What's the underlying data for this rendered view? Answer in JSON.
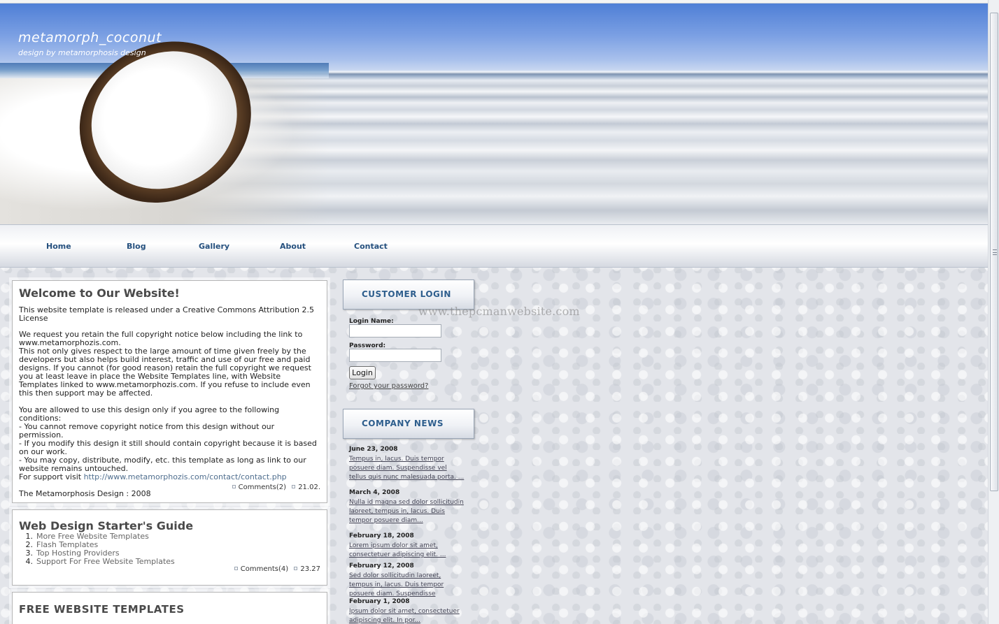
{
  "site": {
    "title": "metamorph_coconut",
    "subtitle": "design by metamorphosis design"
  },
  "nav": {
    "items": [
      "Home",
      "Blog",
      "Gallery",
      "About",
      "Contact"
    ]
  },
  "welcome": {
    "title": "Welcome to Our Website!",
    "p1": "This website template is released under a Creative Commons Attribution 2.5 License",
    "p2_lines": [
      "We request you retain the full copyright notice below including the link to www.metamorphozis.com.",
      "This not only gives respect to the large amount of time given freely by the developers but also helps build interest, traffic and use of our free and paid designs. If you cannot (for good reason) retain the full copyright we request you at least leave in place the Website Templates line, with Website Templates linked to www.metamorphozis.com. If you refuse to include even this then support may be affected."
    ],
    "p3_lines": [
      "You are allowed to use this design only if you agree to the following conditions:",
      "- You cannot remove copyright notice from this design without our permission.",
      "- If you modify this design it still should contain copyright because it is based on our work.",
      "- You may copy, distribute, modify, etc. this template as long as link to our website remains untouched."
    ],
    "support_prefix": "For support visit ",
    "support_link": "http://www.metamorphozis.com/contact/contact.php",
    "signature": "The Metamorphosis Design : 2008",
    "comments": "Comments(2)",
    "date": "21.02."
  },
  "guide": {
    "title": "Web Design Starter's Guide",
    "items": [
      {
        "num": "1.",
        "label": "More Free Website Templates"
      },
      {
        "num": "2.",
        "label": "Flash Templates"
      },
      {
        "num": "3.",
        "label": "Top Hosting Providers"
      },
      {
        "num": "4.",
        "label": "Support For Free Website Templates"
      }
    ],
    "comments": "Comments(4)",
    "date": "23.27"
  },
  "free": {
    "title": "FREE WEBSITE TEMPLATES"
  },
  "login": {
    "heading": "CUSTOMER LOGIN",
    "login_label": "Login Name:",
    "password_label": "Password:",
    "login_value": "",
    "password_value": "",
    "button": "Login",
    "forgot": "Forgot your password?"
  },
  "watermark": "www.thepcmanwebsite.com",
  "news": {
    "heading": "COMPANY NEWS",
    "items": [
      {
        "date": "June 23, 2008",
        "text": "Tempus in, lacus. Duis tempor posuere diam. Suspendisse vel tellus quis nunc malesuada porta. ..."
      },
      {
        "date": "March 4, 2008",
        "text": "Nulla id magna sed dolor sollicitudin laoreet, tempus in, lacus. Duis tempor posuere diam..."
      },
      {
        "date": "February 18, 2008",
        "text": "Lorem ipsum dolor sit amet, consectetuer adipiscing elit. ..."
      },
      {
        "date": "February 12, 2008",
        "text": "Sed dolor sollicitudin laoreet, tempus in, lacus. Duis tempor posuere diam. Suspendisse"
      },
      {
        "date": "February 1, 2008",
        "text": "Ipsum dolor sit amet, consectetuer adipiscing elit. In por..."
      }
    ]
  }
}
